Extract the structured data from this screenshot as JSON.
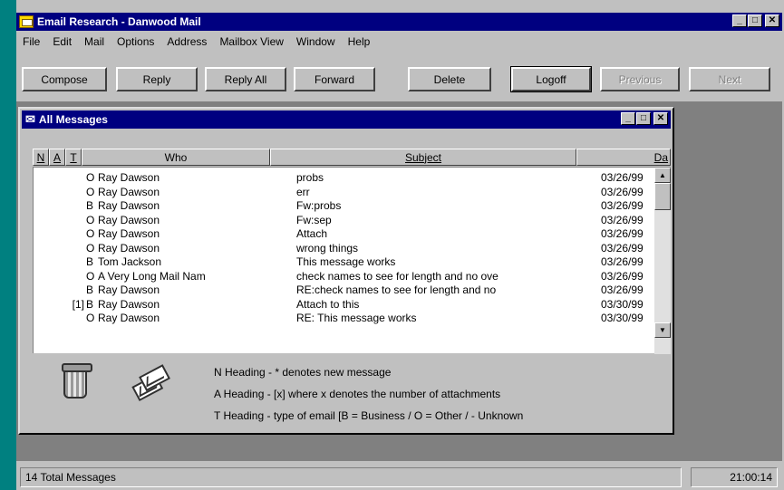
{
  "window": {
    "title": "Email Research - Danwood Mail"
  },
  "menu": [
    "File",
    "Edit",
    "Mail",
    "Options",
    "Address",
    "Mailbox View",
    "Window",
    "Help"
  ],
  "toolbar": {
    "compose": "Compose",
    "reply": "Reply",
    "reply_all": "Reply All",
    "forward": "Forward",
    "delete": "Delete",
    "logoff": "Logoff",
    "previous": "Previous",
    "next": "Next"
  },
  "child_window": {
    "title": "All Messages"
  },
  "columns": {
    "n": "N",
    "a": "A",
    "t": "T",
    "who": "Who",
    "subject": "Subject",
    "date": "Da"
  },
  "messages": [
    {
      "att": "",
      "type": "O",
      "who": "Ray Dawson",
      "subject": "probs",
      "date": "03/26/99"
    },
    {
      "att": "",
      "type": "O",
      "who": "Ray Dawson",
      "subject": "err",
      "date": "03/26/99"
    },
    {
      "att": "",
      "type": "B",
      "who": "Ray Dawson",
      "subject": "Fw:probs",
      "date": "03/26/99"
    },
    {
      "att": "",
      "type": "O",
      "who": "Ray Dawson",
      "subject": "Fw:sep",
      "date": "03/26/99"
    },
    {
      "att": "",
      "type": "O",
      "who": "Ray Dawson",
      "subject": "Attach",
      "date": "03/26/99"
    },
    {
      "att": "",
      "type": "O",
      "who": "Ray Dawson",
      "subject": "wrong things",
      "date": "03/26/99"
    },
    {
      "att": "",
      "type": "B",
      "who": "Tom Jackson",
      "subject": "This message works",
      "date": "03/26/99"
    },
    {
      "att": "",
      "type": "O",
      "who": "A Very Long Mail Nam",
      "subject": "check names to see for length and no ove",
      "date": "03/26/99"
    },
    {
      "att": "",
      "type": "B",
      "who": "Ray Dawson",
      "subject": "RE:check names to see for length and no",
      "date": "03/26/99"
    },
    {
      "att": "[1]",
      "type": "B",
      "who": "Ray Dawson",
      "subject": "Attach to this",
      "date": "03/30/99"
    },
    {
      "att": "",
      "type": "O",
      "who": "Ray Dawson",
      "subject": "RE: This message works",
      "date": "03/30/99"
    }
  ],
  "legend": {
    "n_heading": "N Heading - * denotes new message",
    "a_heading": "A Heading - [x] where x denotes the number of attachments",
    "t_heading": "T Heading - type of email [B = Business / O = Other / - Unknown"
  },
  "status": {
    "total": "14 Total Messages",
    "time": "21:00:14"
  },
  "icons": {
    "app": "mail-app-icon",
    "child": "all-messages-icon",
    "trash": "trash-can-icon",
    "mail": "envelopes-icon"
  },
  "colors": {
    "title_bar": "#000080",
    "face": "#c0c0c0",
    "mdi_background": "#808080"
  }
}
